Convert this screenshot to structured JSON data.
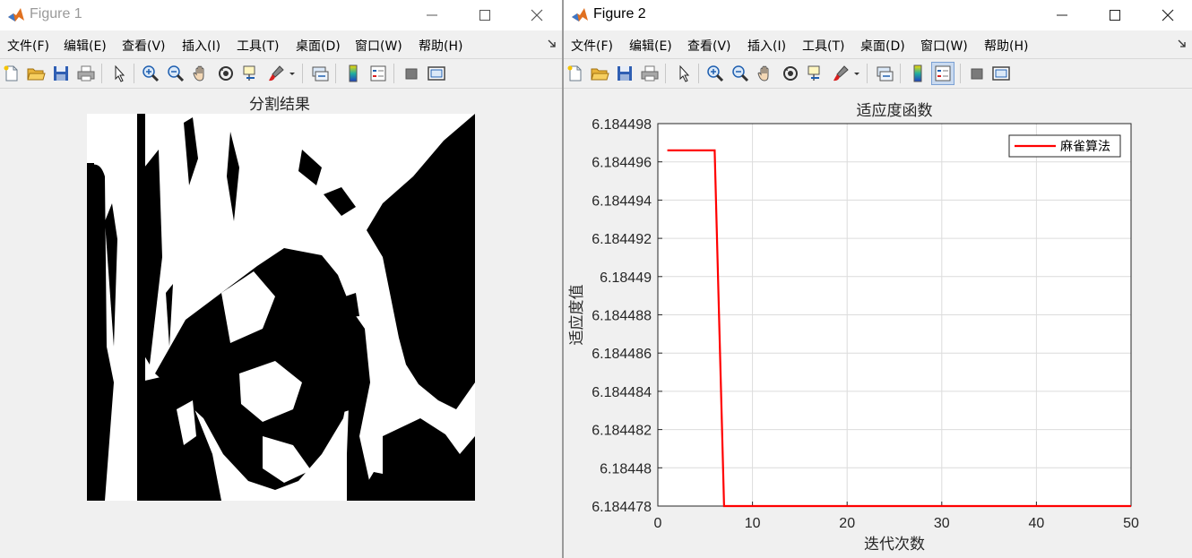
{
  "window1": {
    "title": "Figure 1",
    "menu": [
      "文件(F)",
      "编辑(E)",
      "查看(V)",
      "插入(I)",
      "工具(T)",
      "桌面(D)",
      "窗口(W)",
      "帮助(H)"
    ],
    "axes_title": "分割结果"
  },
  "window2": {
    "title": "Figure 2",
    "menu": [
      "文件(F)",
      "编辑(E)",
      "查看(V)",
      "插入(I)",
      "工具(T)",
      "桌面(D)",
      "窗口(W)",
      "帮助(H)"
    ]
  },
  "toolbar_icons": [
    "new-figure-icon",
    "open-file-icon",
    "save-icon",
    "print-icon",
    "select-arrow-icon",
    "zoom-in-icon",
    "zoom-out-icon",
    "pan-hand-icon",
    "rotate-3d-icon",
    "data-cursor-icon",
    "brush-icon",
    "brush-dropdown-icon",
    "link-plot-icon",
    "colorbar-icon",
    "legend-icon",
    "hide-plot-tools-icon",
    "show-plot-tools-icon"
  ],
  "colors": {
    "line": "#ff0000",
    "grid": "#dcdcdc",
    "axes_bg": "#ffffff",
    "figure_bg": "#f0f0f0"
  },
  "chart_data": {
    "type": "line",
    "title": "适应度函数",
    "xlabel": "迭代次数",
    "ylabel": "适应度值",
    "xlim": [
      0,
      50
    ],
    "ylim": [
      6.184478,
      6.184498
    ],
    "xticks": [
      0,
      10,
      20,
      30,
      40,
      50
    ],
    "yticks": [
      6.184478,
      6.18448,
      6.184482,
      6.184484,
      6.184486,
      6.184488,
      6.18449,
      6.184492,
      6.184494,
      6.184496,
      6.184498
    ],
    "ytick_labels": [
      "6.184478",
      "6.18448",
      "6.184482",
      "6.184484",
      "6.184486",
      "6.184488",
      "6.18449",
      "6.184492",
      "6.184494",
      "6.184496",
      "6.184498"
    ],
    "grid": true,
    "legend_position": "top-right",
    "series": [
      {
        "name": "麻雀算法",
        "x": [
          1,
          2,
          3,
          4,
          5,
          6,
          7,
          8,
          9,
          10,
          11,
          12,
          13,
          14,
          15,
          16,
          17,
          18,
          19,
          20,
          21,
          22,
          23,
          24,
          25,
          26,
          27,
          28,
          29,
          30,
          31,
          32,
          33,
          34,
          35,
          36,
          37,
          38,
          39,
          40,
          41,
          42,
          43,
          44,
          45,
          46,
          47,
          48,
          49,
          50
        ],
        "y": [
          6.1844966,
          6.1844966,
          6.1844966,
          6.1844966,
          6.1844966,
          6.1844966,
          6.184478,
          6.184478,
          6.184478,
          6.184478,
          6.184478,
          6.184478,
          6.184478,
          6.184478,
          6.184478,
          6.184478,
          6.184478,
          6.184478,
          6.184478,
          6.184478,
          6.184478,
          6.184478,
          6.184478,
          6.184478,
          6.184478,
          6.184478,
          6.184478,
          6.184478,
          6.184478,
          6.184478,
          6.184478,
          6.184478,
          6.184478,
          6.184478,
          6.184478,
          6.184478,
          6.184478,
          6.184478,
          6.184478,
          6.184478,
          6.184478,
          6.184478,
          6.184478,
          6.184478,
          6.184478,
          6.184478,
          6.184478,
          6.184478,
          6.184478,
          6.184478
        ]
      }
    ]
  }
}
